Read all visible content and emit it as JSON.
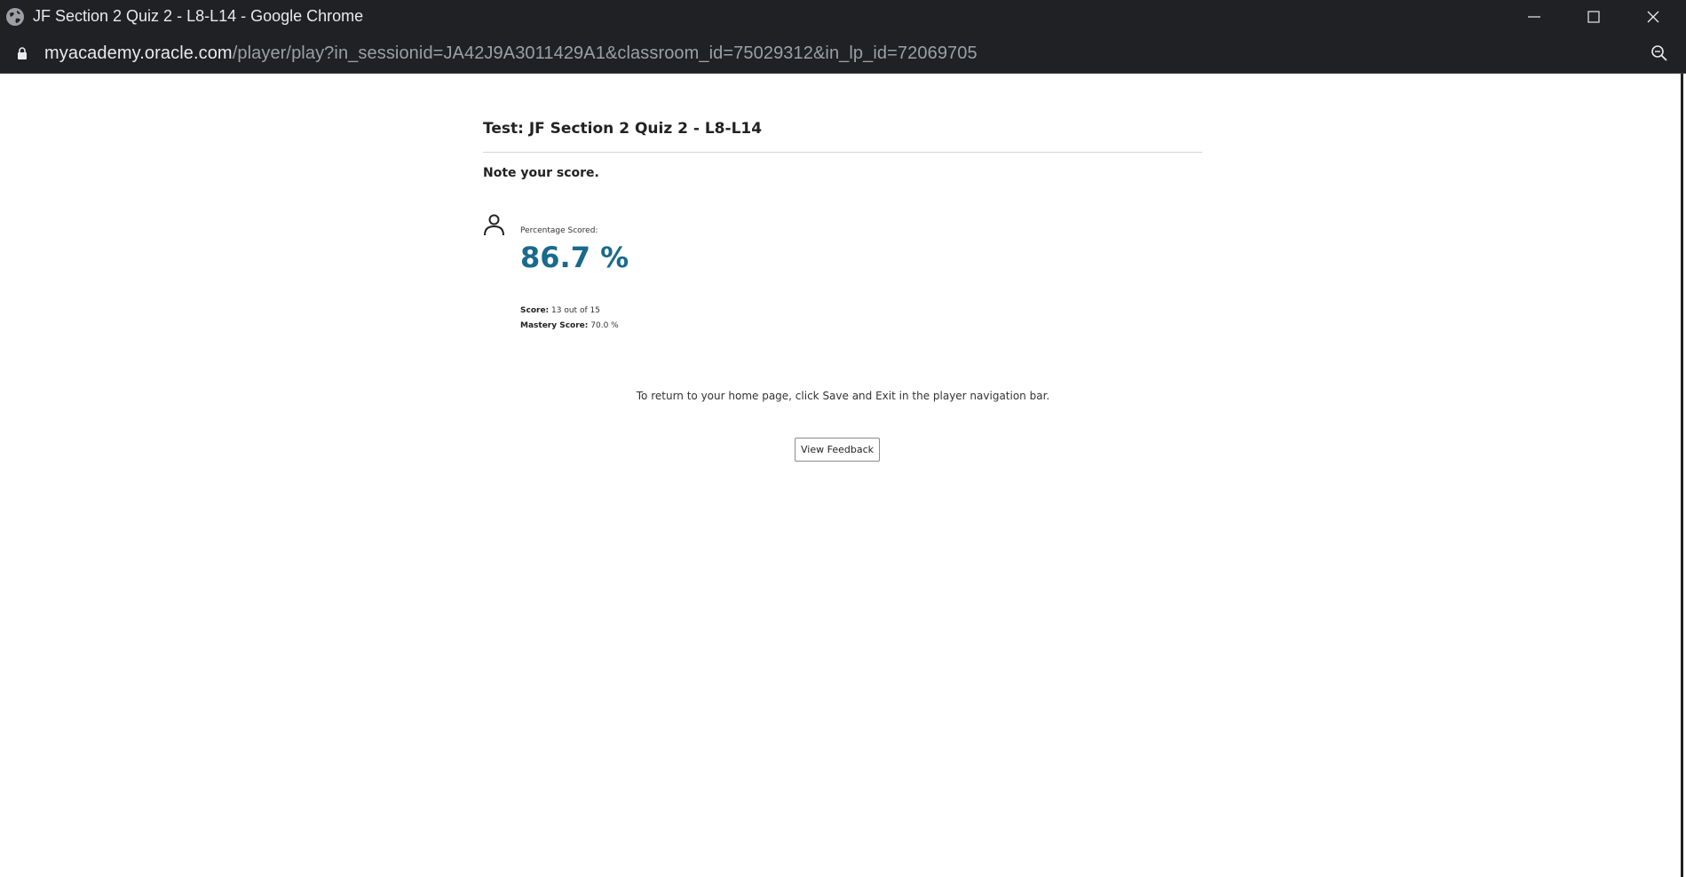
{
  "window": {
    "title": "JF Section 2 Quiz 2 - L8-L14 - Google Chrome"
  },
  "addressbar": {
    "host": "myacademy.oracle.com",
    "path": "/player/play?in_sessionid=JA42J9A3011429A1&classroom_id=75029312&in_lp_id=72069705"
  },
  "page": {
    "test_title": "Test: JF Section 2 Quiz 2 - L8-L14",
    "note": "Note your score.",
    "percentage_label": "Percentage Scored:",
    "percentage_value": "86.7 %",
    "score_label": "Score:",
    "score_value": "13 out of 15",
    "mastery_label": "Mastery Score:",
    "mastery_value": "70.0 %",
    "return_message": "To return to your home page, click Save and Exit in the player navigation bar.",
    "feedback_button": "View Feedback"
  },
  "colors": {
    "titlebar_bg": "#202124",
    "score_accent": "#1a6a8d"
  },
  "icons": [
    "globe-icon",
    "minimize-icon",
    "maximize-icon",
    "close-icon",
    "lock-icon",
    "zoom-icon",
    "user-icon"
  ]
}
